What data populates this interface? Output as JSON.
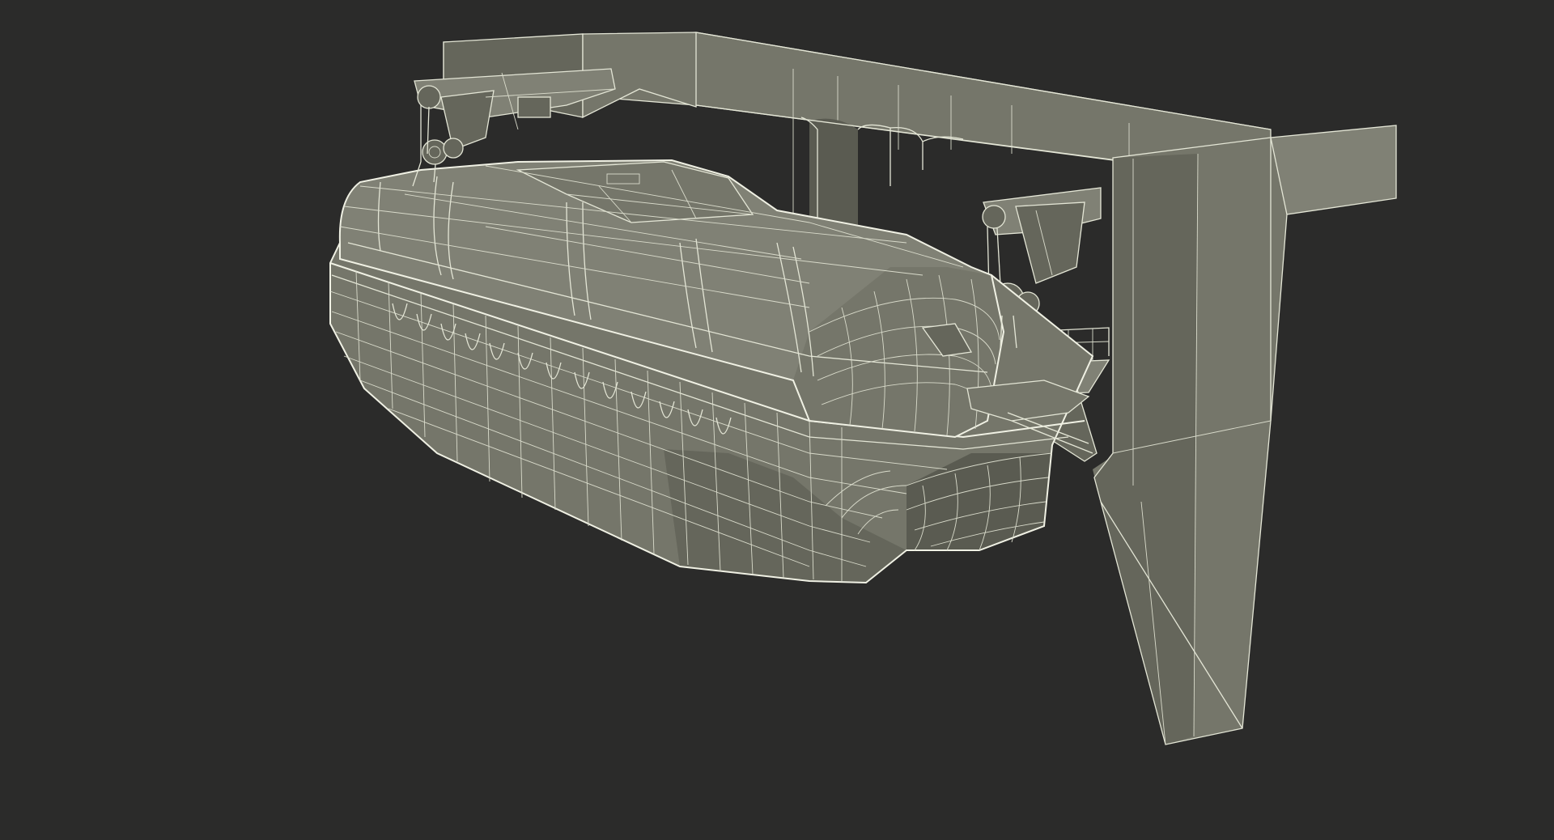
{
  "scene": {
    "subject": "",
    "background_color": "#2b2b2a",
    "model_fill_color": "#75766a",
    "wire_color": "#e4e6d6"
  }
}
